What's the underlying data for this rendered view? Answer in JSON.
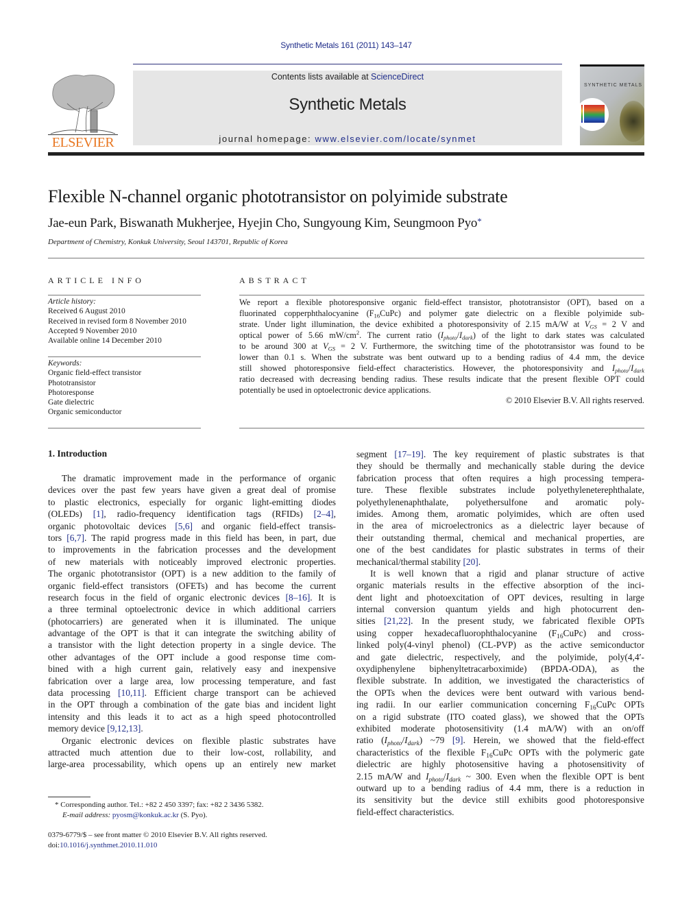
{
  "header": {
    "running_head": "Synthetic Metals 161 (2011) 143–147",
    "contents_prefix": "Contents lists available at ",
    "contents_link": "ScienceDirect",
    "journal_title": "Synthetic Metals",
    "homepage_prefix": "journal homepage: ",
    "homepage_link": "www.elsevier.com/locate/synmet",
    "publisher_logo_text": "ELSEVIER",
    "cover_title": "SYNTHETIC METALS"
  },
  "colors": {
    "link": "#1f2d8a",
    "elsevier_orange": "#e87722",
    "header_box": "#e6e6e6"
  },
  "article": {
    "title": "Flexible N-channel organic phototransistor on polyimide substrate",
    "authors": "Jae-eun Park, Biswanath Mukherjee, Hyejin Cho, Sungyoung Kim, Seungmoon Pyo",
    "corresponding_mark": "*",
    "affiliation": "Department of Chemistry, Konkuk University, Seoul 143701, Republic of Korea"
  },
  "article_info": {
    "heading": "ARTICLE INFO",
    "history_label": "Article history:",
    "history": [
      "Received 6 August 2010",
      "Received in revised form 8 November 2010",
      "Accepted 9 November 2010",
      "Available online 14 December 2010"
    ],
    "keywords_label": "Keywords:",
    "keywords": [
      "Organic field-effect transistor",
      "Phototransistor",
      "Photoresponse",
      "Gate dielectric",
      "Organic semiconductor"
    ]
  },
  "abstract": {
    "heading": "ABSTRACT",
    "lines": [
      [
        {
          "t": "We report a flexible photoresponsive organic field-effect transistor, phototransistor (OPT), based on a"
        }
      ],
      [
        {
          "t": "fluorinated copperphthalocyanine (F"
        },
        {
          "sub": "16"
        },
        {
          "t": "CuPc) and polymer gate dielectric on a flexible polyimide sub-"
        }
      ],
      [
        {
          "t": "strate. Under light illumination, the device exhibited a photoresponsivity of 2.15 mA/W at "
        },
        {
          "i": "V"
        },
        {
          "sub": "GS"
        },
        {
          "t": " = 2 V and"
        }
      ],
      [
        {
          "t": "optical power of 5.66 mW/cm"
        },
        {
          "sup": "2"
        },
        {
          "t": ". The current ratio ("
        },
        {
          "i": "I"
        },
        {
          "sub": "photo"
        },
        {
          "t": "/"
        },
        {
          "i": "I"
        },
        {
          "sub": "dark"
        },
        {
          "t": ") of the light to dark states was calculated"
        }
      ],
      [
        {
          "t": "to be around 300 at "
        },
        {
          "i": "V"
        },
        {
          "sub": "GS"
        },
        {
          "t": " = 2 V. Furthermore, the switching time of the phototransistor was found to be"
        }
      ],
      [
        {
          "t": "lower than 0.1 s. When the substrate was bent outward up to a bending radius of 4.4 mm, the device"
        }
      ],
      [
        {
          "t": "still showed photoresponsive field-effect characteristics. However, the photoresponsivity and "
        },
        {
          "i": "I"
        },
        {
          "sub": "photo"
        },
        {
          "t": "/"
        },
        {
          "i": "I"
        },
        {
          "sub": "dark"
        }
      ],
      [
        {
          "t": "ratio decreased with decreasing bending radius. These results indicate that the present flexible OPT could"
        }
      ],
      [
        {
          "t": "potentially be used in optoelectronic device applications."
        }
      ]
    ],
    "copyright": "© 2010 Elsevier B.V. All rights reserved."
  },
  "intro": {
    "heading": "1.  Introduction",
    "left_column": [
      {
        "indent": true,
        "segs": [
          {
            "t": "The dramatic improvement made in the performance of organic"
          }
        ]
      },
      {
        "segs": [
          {
            "t": "devices over the past few years have given a great deal of promise"
          }
        ]
      },
      {
        "segs": [
          {
            "t": "to plastic electronics, especially for organic light-emitting diodes"
          }
        ]
      },
      {
        "segs": [
          {
            "t": "(OLEDs) "
          },
          {
            "c": "[1]"
          },
          {
            "t": ", radio-frequency identification tags (RFIDs) "
          },
          {
            "c": "[2–4]"
          },
          {
            "t": ","
          }
        ]
      },
      {
        "segs": [
          {
            "t": "organic photovoltaic devices "
          },
          {
            "c": "[5,6]"
          },
          {
            "t": " and organic field-effect transis-"
          }
        ]
      },
      {
        "segs": [
          {
            "t": "tors "
          },
          {
            "c": "[6,7]"
          },
          {
            "t": ". The rapid progress made in this field has been, in part, due"
          }
        ]
      },
      {
        "segs": [
          {
            "t": "to improvements in the fabrication processes and the development"
          }
        ]
      },
      {
        "segs": [
          {
            "t": "of new materials with noticeably improved electronic properties."
          }
        ]
      },
      {
        "segs": [
          {
            "t": "The organic phototransistor (OPT) is a new addition to the family of"
          }
        ]
      },
      {
        "segs": [
          {
            "t": "organic field-effect transistors (OFETs) and has become the current"
          }
        ]
      },
      {
        "segs": [
          {
            "t": "research focus in the field of organic electronic devices "
          },
          {
            "c": "[8–16]"
          },
          {
            "t": ". It is"
          }
        ]
      },
      {
        "segs": [
          {
            "t": "a three terminal optoelectronic device in which additional carriers"
          }
        ]
      },
      {
        "segs": [
          {
            "t": "(photocarriers) are generated when it is illuminated. The unique"
          }
        ]
      },
      {
        "segs": [
          {
            "t": "advantage of the OPT is that it can integrate the switching ability of"
          }
        ]
      },
      {
        "segs": [
          {
            "t": "a transistor with the light detection property in a single device. The"
          }
        ]
      },
      {
        "segs": [
          {
            "t": "other advantages of the OPT include a good response time com-"
          }
        ]
      },
      {
        "segs": [
          {
            "t": "bined with a high current gain, relatively easy and inexpensive"
          }
        ]
      },
      {
        "segs": [
          {
            "t": "fabrication over a large area, low processing temperature, and fast"
          }
        ]
      },
      {
        "segs": [
          {
            "t": "data processing "
          },
          {
            "c": "[10,11]"
          },
          {
            "t": ". Efficient charge transport can be achieved"
          }
        ]
      },
      {
        "segs": [
          {
            "t": "in the OPT through a combination of the gate bias and incident light"
          }
        ]
      },
      {
        "segs": [
          {
            "t": "intensity and this leads it to act as a high speed photocontrolled"
          }
        ]
      },
      {
        "last": true,
        "segs": [
          {
            "t": "memory device "
          },
          {
            "c": "[9,12,13]"
          },
          {
            "t": "."
          }
        ]
      },
      {
        "indent": true,
        "segs": [
          {
            "t": "Organic electronic devices on flexible plastic substrates have"
          }
        ]
      },
      {
        "segs": [
          {
            "t": "attracted much attention due to their low-cost, rollability, and"
          }
        ]
      },
      {
        "segs": [
          {
            "t": "large-area processability, which opens up an entirely new market"
          }
        ]
      }
    ],
    "right_column": [
      {
        "segs": [
          {
            "t": "segment "
          },
          {
            "c": "[17–19]"
          },
          {
            "t": ". The key requirement of plastic substrates is that"
          }
        ]
      },
      {
        "segs": [
          {
            "t": "they should be thermally and mechanically stable during the device"
          }
        ]
      },
      {
        "segs": [
          {
            "t": "fabrication process that often requires a high processing tempera-"
          }
        ]
      },
      {
        "segs": [
          {
            "t": "ture. These flexible substrates include polyethyleneterephthalate,"
          }
        ]
      },
      {
        "segs": [
          {
            "t": "polyethylenenaphthalate, polyethersulfone and aromatic poly-"
          }
        ]
      },
      {
        "segs": [
          {
            "t": "imides. Among them, aromatic polyimides, which are often used"
          }
        ]
      },
      {
        "segs": [
          {
            "t": "in the area of microelectronics as a dielectric layer because of"
          }
        ]
      },
      {
        "segs": [
          {
            "t": "their outstanding thermal, chemical and mechanical properties, are"
          }
        ]
      },
      {
        "segs": [
          {
            "t": "one of the best candidates for plastic substrates in terms of their"
          }
        ]
      },
      {
        "last": true,
        "segs": [
          {
            "t": "mechanical/thermal stability "
          },
          {
            "c": "[20]"
          },
          {
            "t": "."
          }
        ]
      },
      {
        "indent": true,
        "segs": [
          {
            "t": "It is well known that a rigid and planar structure of active"
          }
        ]
      },
      {
        "segs": [
          {
            "t": "organic materials results in the effective absorption of the inci-"
          }
        ]
      },
      {
        "segs": [
          {
            "t": "dent light and photoexcitation of OPT devices, resulting in large"
          }
        ]
      },
      {
        "segs": [
          {
            "t": "internal conversion quantum yields and high photocurrent den-"
          }
        ]
      },
      {
        "segs": [
          {
            "t": "sities "
          },
          {
            "c": "[21,22]"
          },
          {
            "t": ". In the present study, we fabricated flexible OPTs"
          }
        ]
      },
      {
        "segs": [
          {
            "t": "using copper hexadecafluorophthalocyanine (F"
          },
          {
            "sub": "16"
          },
          {
            "t": "CuPc) and cross-"
          }
        ]
      },
      {
        "segs": [
          {
            "t": "linked poly(4-vinyl phenol) (CL-PVP) as the active semiconductor"
          }
        ]
      },
      {
        "segs": [
          {
            "t": "and gate dielectric, respectively, and the polyimide, poly(4,4′-"
          }
        ]
      },
      {
        "segs": [
          {
            "t": "oxydiphenylene biphenyltetracarboximide) (BPDA-ODA), as the"
          }
        ]
      },
      {
        "segs": [
          {
            "t": "flexible substrate. In addition, we investigated the characteristics of"
          }
        ]
      },
      {
        "segs": [
          {
            "t": "the OPTs when the devices were bent outward with various bend-"
          }
        ]
      },
      {
        "segs": [
          {
            "t": "ing radii. In our earlier communication concerning F"
          },
          {
            "sub": "16"
          },
          {
            "t": "CuPc OPTs"
          }
        ]
      },
      {
        "segs": [
          {
            "t": "on a rigid substrate (ITO coated glass), we showed that the OPTs"
          }
        ]
      },
      {
        "segs": [
          {
            "t": "exhibited moderate photosensitivity (1.4 mA/W) with an on/off"
          }
        ]
      },
      {
        "segs": [
          {
            "t": "ratio ("
          },
          {
            "i": "I"
          },
          {
            "sub": "photo"
          },
          {
            "t": "/"
          },
          {
            "i": "I"
          },
          {
            "sub": "dark"
          },
          {
            "t": ") ~79 "
          },
          {
            "c": "[9]"
          },
          {
            "t": ". Herein, we showed that the field-effect"
          }
        ]
      },
      {
        "segs": [
          {
            "t": "characteristics of the flexible F"
          },
          {
            "sub": "16"
          },
          {
            "t": "CuPc OPTs with the polymeric gate"
          }
        ]
      },
      {
        "segs": [
          {
            "t": "dielectric are highly photosensitive having a photosensitivity of"
          }
        ]
      },
      {
        "segs": [
          {
            "t": "2.15 mA/W and "
          },
          {
            "i": "I"
          },
          {
            "sub": "photo"
          },
          {
            "t": "/"
          },
          {
            "i": "I"
          },
          {
            "sub": "dark"
          },
          {
            "t": " ~ 300. Even when the flexible OPT is bent"
          }
        ]
      },
      {
        "segs": [
          {
            "t": "outward up to a bending radius of 4.4 mm, there is a reduction in"
          }
        ]
      },
      {
        "segs": [
          {
            "t": "its sensitivity but the device still exhibits good photoresponsive"
          }
        ]
      },
      {
        "last": true,
        "segs": [
          {
            "t": "field-effect characteristics."
          }
        ]
      }
    ]
  },
  "footnote": {
    "line1": "* Corresponding author. Tel.: +82 2 450 3397; fax: +82 2 3436 5382.",
    "email_label": "E-mail address: ",
    "email": "pyosm@konkuk.ac.kr",
    "email_suffix": " (S. Pyo)."
  },
  "frontmatter": {
    "issn_line": "0379-6779/$ – see front matter © 2010 Elsevier B.V. All rights reserved.",
    "doi_prefix": "doi:",
    "doi": "10.1016/j.synthmet.2010.11.010"
  }
}
